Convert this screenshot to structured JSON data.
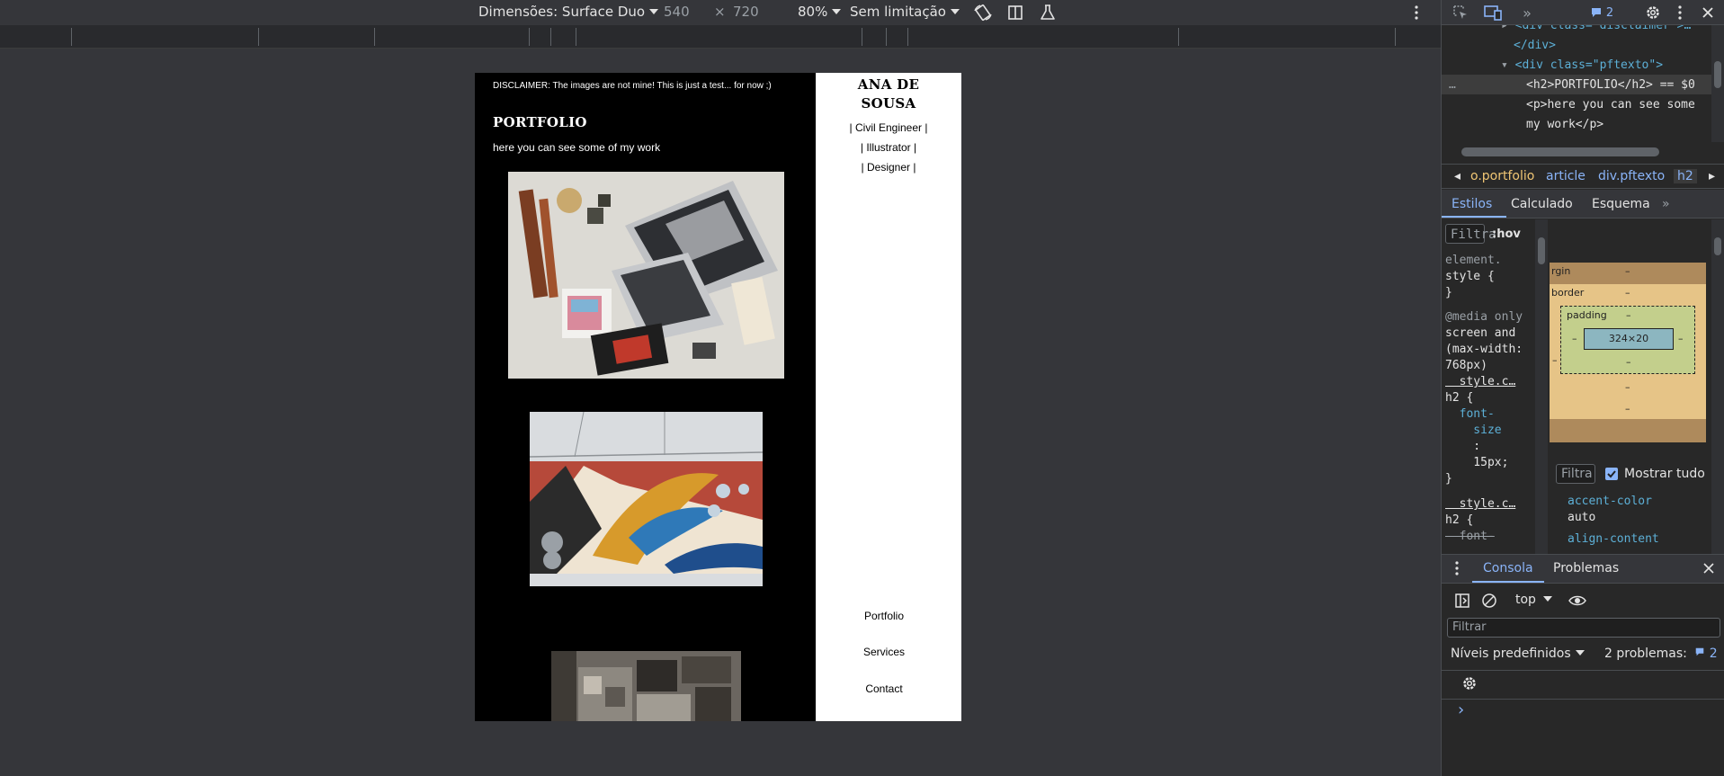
{
  "device_toolbar": {
    "dimensions_label": "Dimensões: Surface Duo",
    "width": "540",
    "times": "×",
    "height": "720",
    "zoom": "80%",
    "throttle": "Sem limitação"
  },
  "page": {
    "disclaimer": "DISCLAIMER: The images are not mine! This is just a test... for now ;)",
    "title": "PORTFOLIO",
    "subtitle": "here you can see some of my work",
    "sidebar": {
      "name_line1": "ANA DE",
      "name_line2": "SOUSA",
      "roles": [
        "| Civil Engineer |",
        "| Illustrator |",
        "| Designer |"
      ],
      "nav": [
        "Portfolio",
        "Services",
        "Contact"
      ]
    }
  },
  "devtools": {
    "issues_count": "2",
    "elements_lines": [
      {
        "text": "<div class=\"disclaimer\">…"
      },
      {
        "text": "</div>"
      },
      {
        "text": "<div class=\"pftexto\">"
      },
      {
        "text": "<h2>PORTFOLIO</h2> == $0"
      },
      {
        "text": "<p>here you can see some"
      },
      {
        "text": "my work</p>"
      }
    ],
    "breadcrumb": [
      "o.portfolio",
      "article",
      "div.pftexto",
      "h2"
    ],
    "style_tabs": [
      "Estilos",
      "Calculado",
      "Esquema"
    ],
    "styles_filter": "Filtra",
    "hov": ":hov",
    "css_lines": [
      "element.",
      "style {",
      "}",
      "@media only",
      "screen and",
      "(max-width:",
      "768px)",
      "  style.c…",
      "h2 {",
      "  font-",
      "    size",
      "    :",
      "    15px;",
      "}",
      "  style.c…",
      "h2 {",
      "  font-"
    ],
    "box_model": {
      "margin_label": "rgin",
      "border_label": "border",
      "padding_label": "padding",
      "content_size": "324×20",
      "dash": "–"
    },
    "computed_filter": "Filtra",
    "show_all": "Mostrar tudo",
    "computed_props": [
      {
        "name": "accent-color",
        "value": "auto"
      },
      {
        "name": "align-content",
        "value": ""
      }
    ],
    "console_tabs": [
      "Consola",
      "Problemas"
    ],
    "console_context": "top",
    "console_filter": "Filtrar",
    "levels": "Níveis predefinidos",
    "problems": "2 problemas:",
    "problems_count": "2",
    "prompt": "›"
  },
  "colors": {
    "accent": "#8ab4f8",
    "devtools_bg": "#282828",
    "toolbar_bg": "#35363a"
  }
}
